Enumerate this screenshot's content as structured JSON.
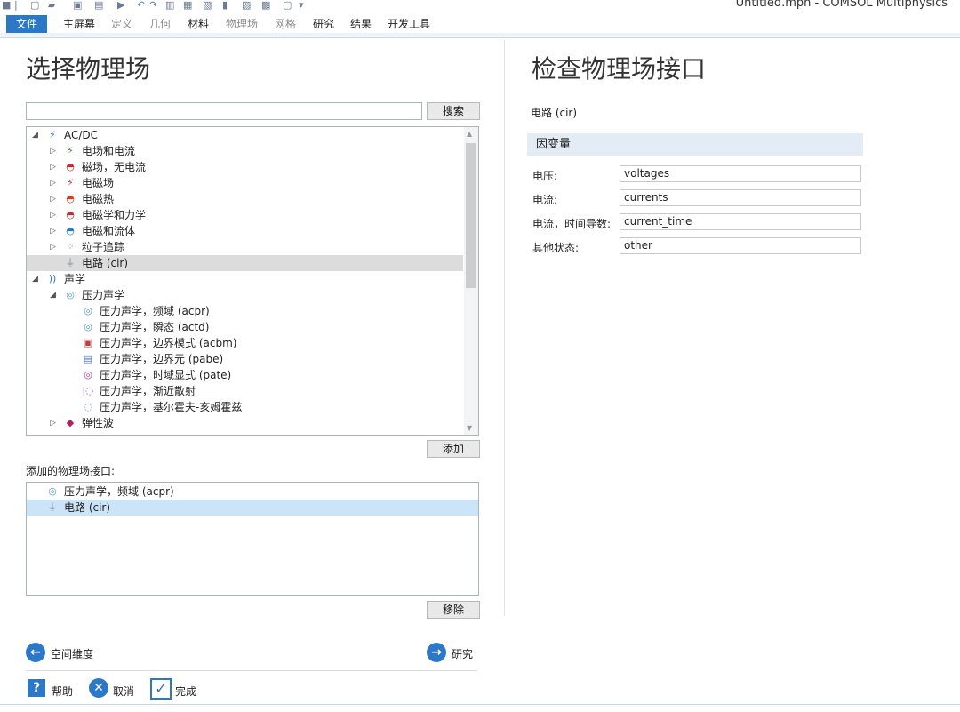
{
  "window": {
    "title": "Untitled.mph - COMSOL Multiphysics"
  },
  "ribbon": {
    "tabs": [
      "文件",
      "主屏幕",
      "定义",
      "几何",
      "材料",
      "物理场",
      "网格",
      "研究",
      "结果",
      "开发工具"
    ]
  },
  "left": {
    "heading": "选择物理场",
    "search_value": "",
    "search_button": "搜索",
    "tree": [
      {
        "label": "AC/DC",
        "level": 0,
        "toggle": "expanded",
        "icon": "acdc-icon"
      },
      {
        "label": "电场和电流",
        "level": 1,
        "toggle": "collapsed",
        "icon": "electric-currents-icon"
      },
      {
        "label": "磁场，无电流",
        "level": 1,
        "toggle": "collapsed",
        "icon": "magnetic-no-current-icon"
      },
      {
        "label": "电磁场",
        "level": 1,
        "toggle": "collapsed",
        "icon": "electromagnetic-field-icon"
      },
      {
        "label": "电磁热",
        "level": 1,
        "toggle": "collapsed",
        "icon": "electromagnetic-heating-icon"
      },
      {
        "label": "电磁学和力学",
        "level": 1,
        "toggle": "collapsed",
        "icon": "electromechanics-icon"
      },
      {
        "label": "电磁和流体",
        "level": 1,
        "toggle": "collapsed",
        "icon": "electromagnetics-fluid-icon"
      },
      {
        "label": "粒子追踪",
        "level": 1,
        "toggle": "collapsed",
        "icon": "particle-tracing-icon"
      },
      {
        "label": "电路 (cir)",
        "level": 1,
        "toggle": "none",
        "icon": "electrical-circuit-icon",
        "selected": true
      },
      {
        "label": "声学",
        "level": 0,
        "toggle": "expanded",
        "icon": "acoustics-icon"
      },
      {
        "label": "压力声学",
        "level": 1,
        "toggle": "expanded",
        "icon": "pressure-acoustics-icon"
      },
      {
        "label": "压力声学，频域 (acpr)",
        "level": 2,
        "toggle": "none",
        "icon": "pressure-acoustics-frequency-icon"
      },
      {
        "label": "压力声学，瞬态 (actd)",
        "level": 2,
        "toggle": "none",
        "icon": "pressure-acoustics-transient-icon"
      },
      {
        "label": "压力声学，边界模式 (acbm)",
        "level": 2,
        "toggle": "none",
        "icon": "boundary-mode-icon"
      },
      {
        "label": "压力声学，边界元 (pabe)",
        "level": 2,
        "toggle": "none",
        "icon": "boundary-element-icon"
      },
      {
        "label": "压力声学，时域显式 (pate)",
        "level": 2,
        "toggle": "none",
        "icon": "time-explicit-icon"
      },
      {
        "label": "压力声学，渐近散射",
        "level": 2,
        "toggle": "none",
        "icon": "asymptotic-scattering-icon"
      },
      {
        "label": "压力声学，基尔霍夫-亥姆霍兹",
        "level": 2,
        "toggle": "none",
        "icon": "kirchhoff-helmholtz-icon"
      },
      {
        "label": "弹性波",
        "level": 1,
        "toggle": "collapsed",
        "icon": "elastic-waves-icon"
      }
    ],
    "add_button": "添加",
    "added_label": "添加的物理场接口:",
    "added": [
      {
        "label": "压力声学，频域 (acpr)",
        "icon": "pressure-acoustics-frequency-icon"
      },
      {
        "label": "电路 (cir)",
        "icon": "electrical-circuit-icon",
        "selected": true
      }
    ],
    "remove_button": "移除",
    "back": "空间维度",
    "next": "研究",
    "help": "帮助",
    "cancel": "取消",
    "done": "完成"
  },
  "right": {
    "heading": "检查物理场接口",
    "interface_name": "电路 (cir)",
    "section": "因变量",
    "fields": [
      {
        "label": "电压:",
        "value": "voltages"
      },
      {
        "label": "电流:",
        "value": "currents"
      },
      {
        "label": "电流，时间导数:",
        "value": "current_time"
      },
      {
        "label": "其他状态:",
        "value": "other"
      }
    ]
  },
  "colors": {
    "accent": "#2c78c8",
    "section_bg": "#e3ebf5",
    "tree_selected": "#dcdcdc",
    "list_selected": "#cce4f7"
  }
}
